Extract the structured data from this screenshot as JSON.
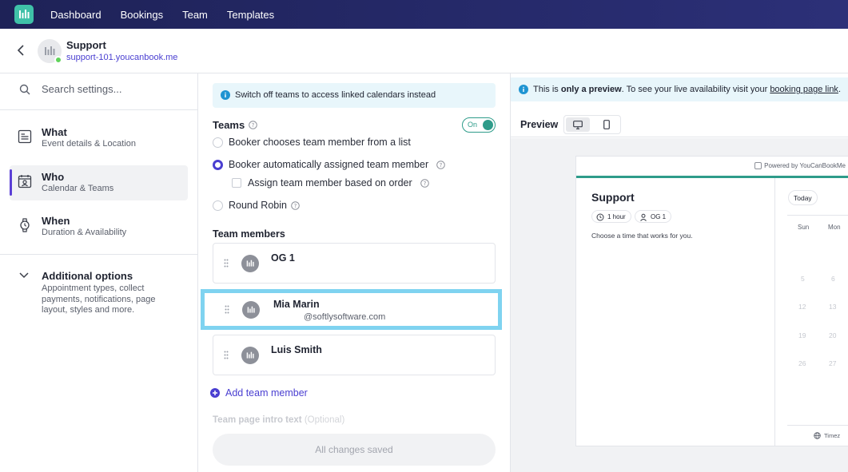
{
  "nav": {
    "items": [
      "Dashboard",
      "Bookings",
      "Team",
      "Templates"
    ]
  },
  "header": {
    "title": "Support",
    "link": "support-101.youcanbook.me"
  },
  "sidebar": {
    "search_placeholder": "Search settings...",
    "items": [
      {
        "title": "What",
        "subtitle": "Event details & Location"
      },
      {
        "title": "Who",
        "subtitle": "Calendar & Teams"
      },
      {
        "title": "When",
        "subtitle": "Duration & Availability"
      }
    ],
    "additional": {
      "title": "Additional options",
      "subtitle": "Appointment types, collect payments, notifications, page layout, styles and more."
    }
  },
  "teams": {
    "banner": "Switch off teams to access linked calendars instead",
    "label": "Teams",
    "toggle_label": "On",
    "options": [
      "Booker chooses team member from a list",
      "Booker automatically assigned team member",
      "Round Robin"
    ],
    "checkbox_label": "Assign team member based on order",
    "members_label": "Team members",
    "members": [
      {
        "name": "OG 1",
        "email": ""
      },
      {
        "name": "Mia Marin",
        "email": "@softlysoftware.com"
      },
      {
        "name": "Luis Smith",
        "email": ""
      }
    ],
    "add_member": "Add team member",
    "intro_label": "Team page intro text",
    "intro_optional": "(Optional)",
    "save_label": "All changes saved"
  },
  "preview": {
    "banner_prefix": "This is ",
    "banner_bold": "only a preview",
    "banner_middle": ". To see your live availability visit your ",
    "banner_link": "booking page link",
    "banner_suffix": ".",
    "label": "Preview",
    "powered_by": "Powered by YouCanBookMe",
    "card_title": "Support",
    "duration": "1 hour",
    "host": "OG 1",
    "description": "Choose a time that works for you.",
    "today_label": "Today",
    "day_headers": [
      "Sun",
      "Mon"
    ],
    "days": [
      [
        "5",
        "6"
      ],
      [
        "12",
        "13"
      ],
      [
        "19",
        "20"
      ],
      [
        "26",
        "27"
      ]
    ],
    "timezone_label": "Timez"
  },
  "colors": {
    "accent": "#2e9c8a",
    "primary": "#4a3fd1",
    "nav_bg": "#1e2257",
    "highlight": "#7fd3f0"
  }
}
